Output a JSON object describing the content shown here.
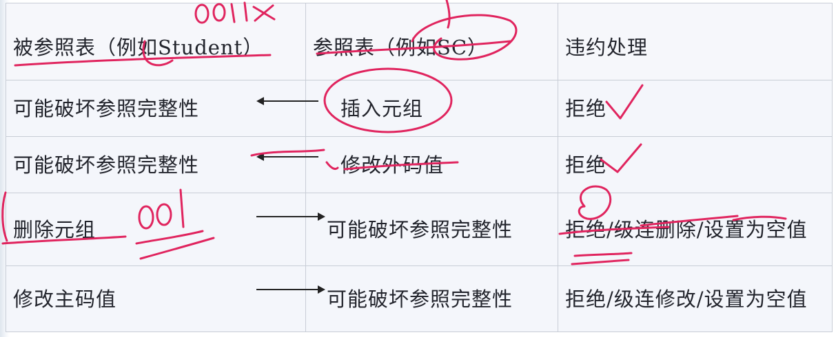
{
  "table": {
    "header": {
      "col1": "被参照表（例如Student）",
      "col2": "参照表（例如SC）",
      "col3": "违约处理"
    },
    "rows": [
      {
        "col1": "可能破坏参照完整性",
        "col2": "插入元组",
        "col3": "拒绝"
      },
      {
        "col1": "可能破坏参照完整性",
        "col2": "修改外码值",
        "col3": "拒绝"
      },
      {
        "col1": "删除元组",
        "col2": "可能破坏参照完整性",
        "col3": "拒绝/级连删除/设置为空值"
      },
      {
        "col1": "修改主码值",
        "col2": "可能破坏参照完整性",
        "col3": "拒绝/级连修改/设置为空值"
      }
    ]
  },
  "annotations": {
    "ink_color": "#e0245e",
    "handwritten_top": "0011",
    "handwritten_row3": "001"
  }
}
